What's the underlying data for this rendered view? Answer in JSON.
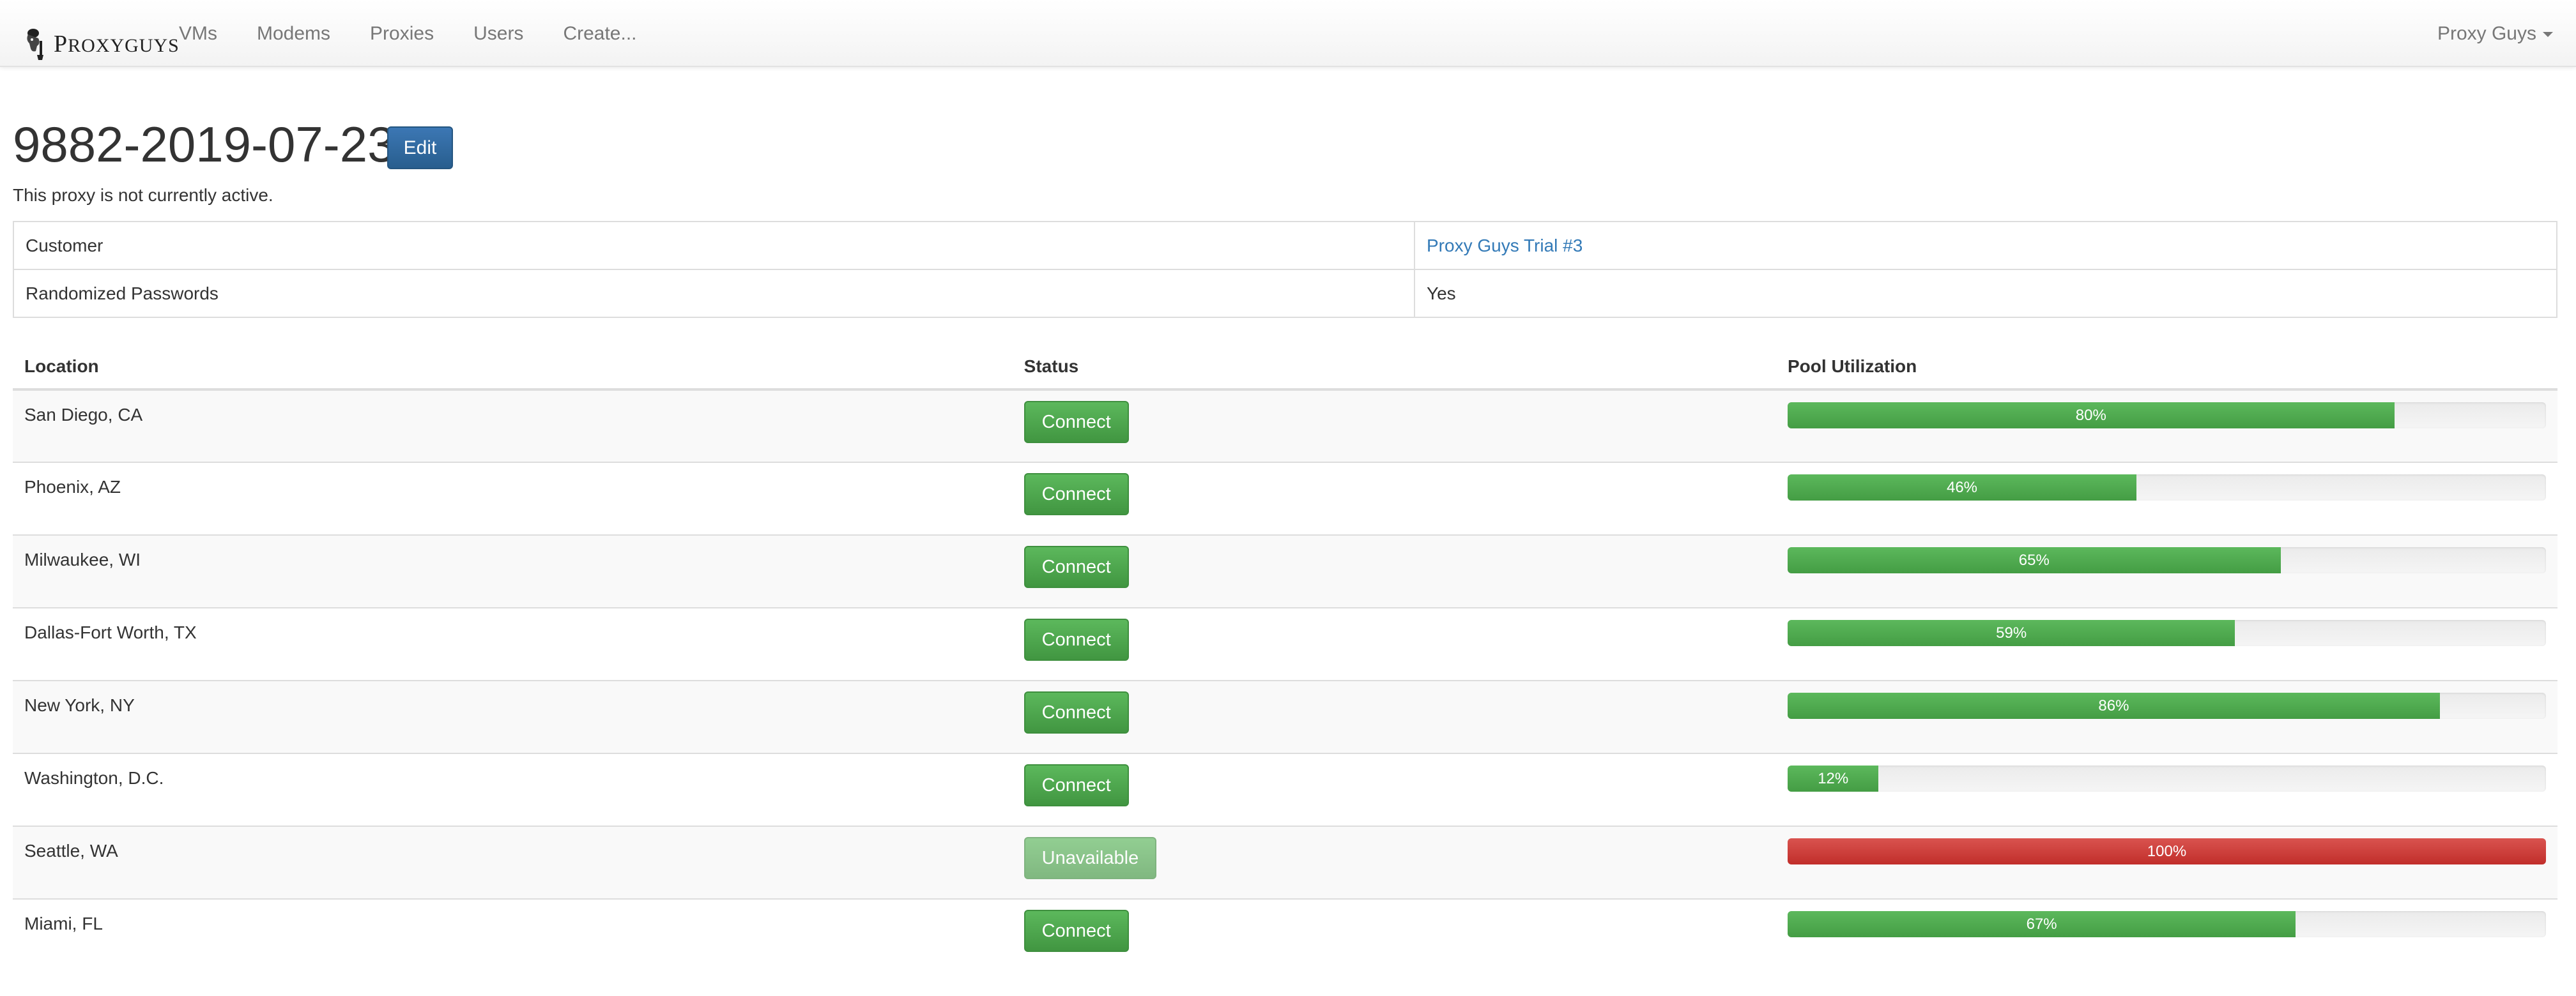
{
  "navbar": {
    "brand": {
      "initial": "P",
      "rest": "ROXYGUYS"
    },
    "links": [
      "VMs",
      "Modems",
      "Proxies",
      "Users",
      "Create..."
    ],
    "user_menu": "Proxy Guys"
  },
  "header": {
    "title": "9882-2019-07-23",
    "edit_label": "Edit",
    "status_text": "This proxy is not currently active."
  },
  "info": {
    "customer_label": "Customer",
    "customer_value": "Proxy Guys Trial #3",
    "randomized_label": "Randomized Passwords",
    "randomized_value": "Yes"
  },
  "locations": {
    "headers": {
      "location": "Location",
      "status": "Status",
      "pool": "Pool Utilization"
    },
    "rows": [
      {
        "location": "San Diego, CA",
        "status": "Connect",
        "available": true,
        "utilization": 80,
        "utilization_label": "80%"
      },
      {
        "location": "Phoenix, AZ",
        "status": "Connect",
        "available": true,
        "utilization": 46,
        "utilization_label": "46%"
      },
      {
        "location": "Milwaukee, WI",
        "status": "Connect",
        "available": true,
        "utilization": 65,
        "utilization_label": "65%"
      },
      {
        "location": "Dallas-Fort Worth, TX",
        "status": "Connect",
        "available": true,
        "utilization": 59,
        "utilization_label": "59%"
      },
      {
        "location": "New York, NY",
        "status": "Connect",
        "available": true,
        "utilization": 86,
        "utilization_label": "86%"
      },
      {
        "location": "Washington, D.C.",
        "status": "Connect",
        "available": true,
        "utilization": 12,
        "utilization_label": "12%"
      },
      {
        "location": "Seattle, WA",
        "status": "Unavailable",
        "available": false,
        "utilization": 100,
        "utilization_label": "100%"
      },
      {
        "location": "Miami, FL",
        "status": "Connect",
        "available": true,
        "utilization": 67,
        "utilization_label": "67%"
      }
    ]
  },
  "colors": {
    "primary": "#337ab7",
    "success": "#5cb85c",
    "danger": "#d9534f"
  }
}
